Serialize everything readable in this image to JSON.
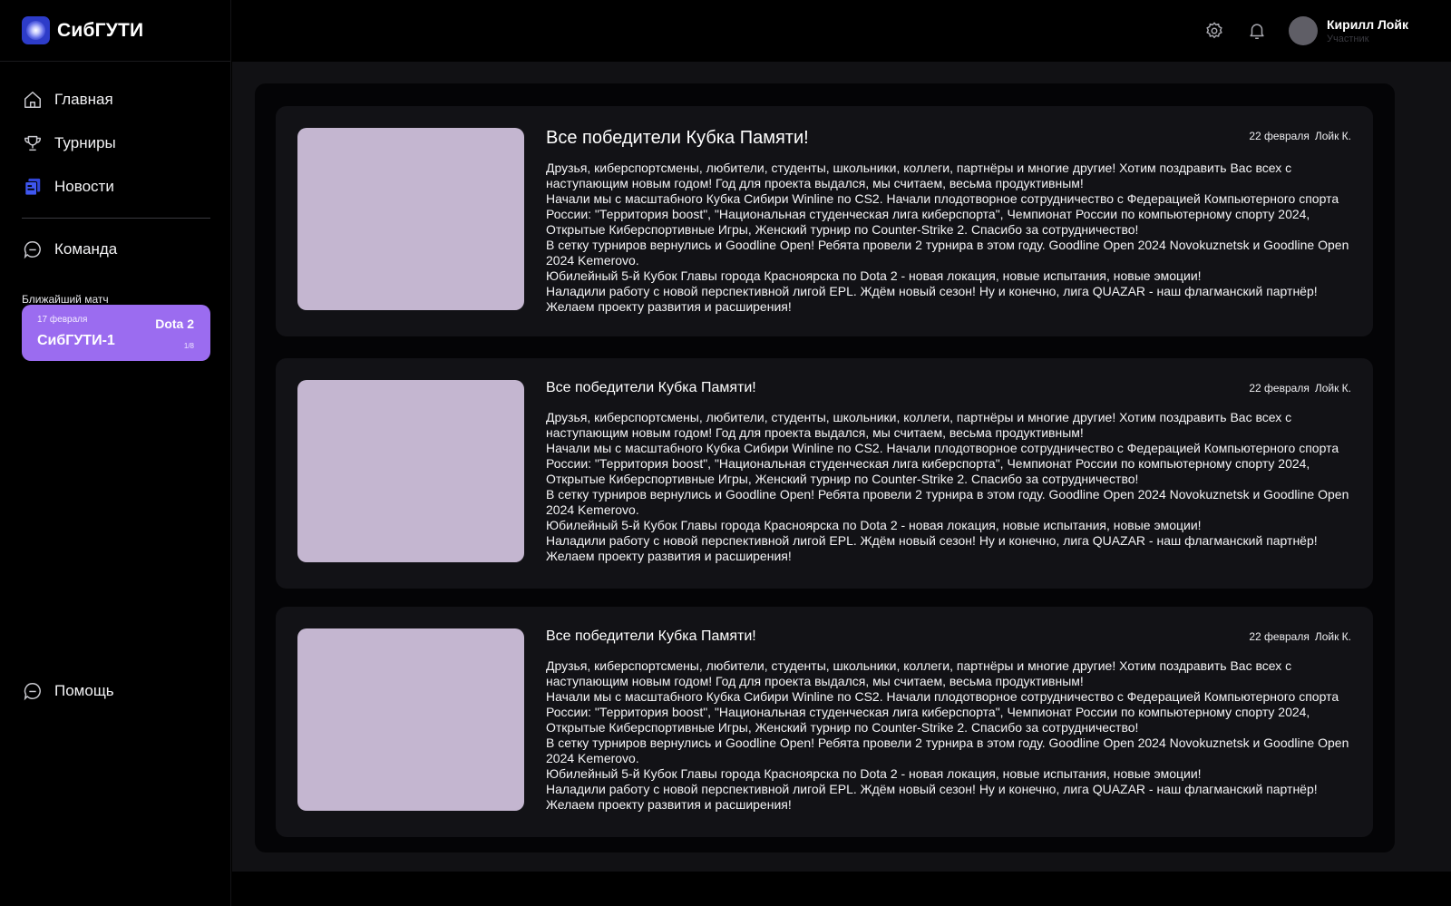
{
  "app": {
    "title": "СибГУТИ"
  },
  "sidebar": {
    "nav": [
      {
        "label": "Главная",
        "icon": "home-icon"
      },
      {
        "label": "Турниры",
        "icon": "trophy-icon"
      },
      {
        "label": "Новости",
        "icon": "news-icon"
      }
    ],
    "team": {
      "label": "Команда",
      "icon": "chat-icon"
    },
    "next_match_title": "Ближайший матч",
    "next_match": {
      "date": "17 февраля",
      "game": "Dota 2",
      "team": "СибГУТИ-1",
      "round": "1/8"
    },
    "help": {
      "label": "Помощь",
      "icon": "chat-icon"
    }
  },
  "header": {
    "settings_icon": "gear-icon",
    "notifications_icon": "bell-icon",
    "user": {
      "name": "Кирилл Лойк",
      "role": "Участник"
    }
  },
  "news": [
    {
      "title": "Все победители Кубка Памяти!",
      "date": "22 февраля",
      "author": "Лойк К.",
      "paragraphs": [
        "Друзья, киберспортсмены, любители, студенты, школьники, коллеги, партнёры и многие другие! Хотим поздравить Вас всех с наступающим новым годом! Год для проекта выдался, мы считаем, весьма продуктивным!",
        "Начали мы с масштабного Кубка Сибири Winline по CS2. Начали плодотворное сотрудничество с Федерацией Компьютерного спорта России: \"Территория boost\", \"Национальная студенческая лига киберспорта\", Чемпионат России по компьютерному спорту 2024, Открытые Киберспортивные Игры, Женский турнир по Counter-Strike 2. Спасибо за сотрудничество!",
        "В сетку турниров вернулись и Goodline Open! Ребята провели 2 турнира в этом году. Goodline Open 2024 Novokuznetsk и Goodline Open 2024 Kemerovo.",
        "Юбилейный 5-й Кубок Главы города Красноярска по Dota 2 - новая локация, новые испытания, новые эмоции!",
        "Наладили работу с новой перспективной лигой EPL. Ждём новый сезон! Ну и конечно, лига QUAZAR - наш флагманский партнёр!",
        "Желаем проекту развития и расширения!"
      ]
    },
    {
      "title": "Все победители Кубка Памяти!",
      "date": "22 февраля",
      "author": "Лойк К.",
      "paragraphs": [
        "Друзья, киберспортсмены, любители, студенты, школьники, коллеги, партнёры и многие другие! Хотим поздравить Вас всех с наступающим новым годом! Год для проекта выдался, мы считаем, весьма продуктивным!",
        "Начали мы с масштабного Кубка Сибири Winline по CS2. Начали плодотворное сотрудничество с Федерацией Компьютерного спорта России: \"Территория boost\", \"Национальная студенческая лига киберспорта\", Чемпионат России по компьютерному спорту 2024, Открытые Киберспортивные Игры, Женский турнир по Counter-Strike 2. Спасибо за сотрудничество!",
        "В сетку турниров вернулись и Goodline Open! Ребята провели 2 турнира в этом году. Goodline Open 2024 Novokuznetsk и Goodline Open 2024 Kemerovo.",
        "Юбилейный 5-й Кубок Главы города Красноярска по Dota 2 - новая локация, новые испытания, новые эмоции!",
        "Наладили работу с новой перспективной лигой EPL. Ждём новый сезон! Ну и конечно, лига QUAZAR - наш флагманский партнёр!",
        "Желаем проекту развития и расширения!"
      ]
    },
    {
      "title": "Все победители Кубка Памяти!",
      "date": "22 февраля",
      "author": "Лойк К.",
      "paragraphs": [
        "Друзья, киберспортсмены, любители, студенты, школьники, коллеги, партнёры и многие другие! Хотим поздравить Вас всех с наступающим новым годом! Год для проекта выдался, мы считаем, весьма продуктивным!",
        "Начали мы с масштабного Кубка Сибири Winline по CS2. Начали плодотворное сотрудничество с Федерацией Компьютерного спорта России: \"Территория boost\", \"Национальная студенческая лига киберспорта\", Чемпионат России по компьютерному спорту 2024, Открытые Киберспортивные Игры, Женский турнир по Counter-Strike 2. Спасибо за сотрудничество!",
        "В сетку турниров вернулись и Goodline Open! Ребята провели 2 турнира в этом году. Goodline Open 2024 Novokuznetsk и Goodline Open 2024 Kemerovo.",
        "Юбилейный 5-й Кубок Главы города Красноярска по Dota 2 - новая локация, новые испытания, новые эмоции!",
        "Наладили работу с новой перспективной лигой EPL. Ждём новый сезон! Ну и конечно, лига QUAZAR - наш флагманский партнёр!",
        "Желаем проекту развития и расширения!"
      ]
    }
  ],
  "colors": {
    "accent_purple": "#9b6cf0",
    "logo_blue": "#2d3cc9",
    "thumb_placeholder": "#c4b6d0",
    "card_bg": "#121216"
  }
}
